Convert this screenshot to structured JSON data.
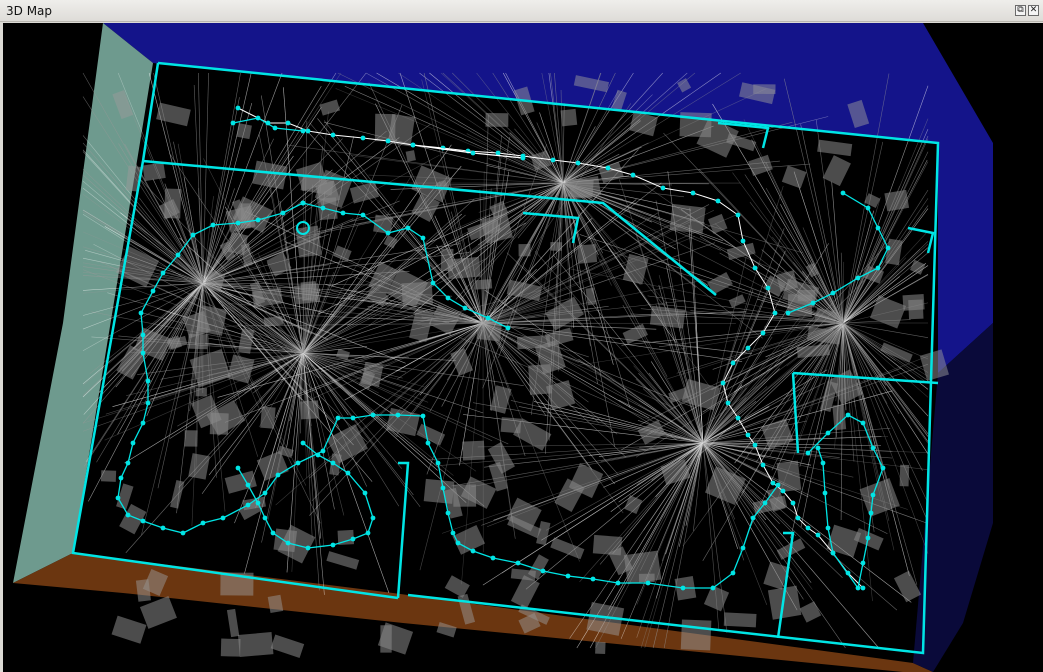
{
  "window": {
    "title": "3D Map",
    "float_icon": "float-icon",
    "close_icon": "close-icon",
    "float_glyph": "⧉",
    "close_glyph": "✕"
  },
  "colors": {
    "background": "#000000",
    "trajectory": "#00e5e5",
    "walls_outline": "#00e5e5",
    "pointcloud": "#9a9a9a",
    "left_wall": "#7aa89a",
    "top_wall": "#1a1a8c",
    "floor_edge": "#7a3d10",
    "path_line": "#ffffff"
  }
}
